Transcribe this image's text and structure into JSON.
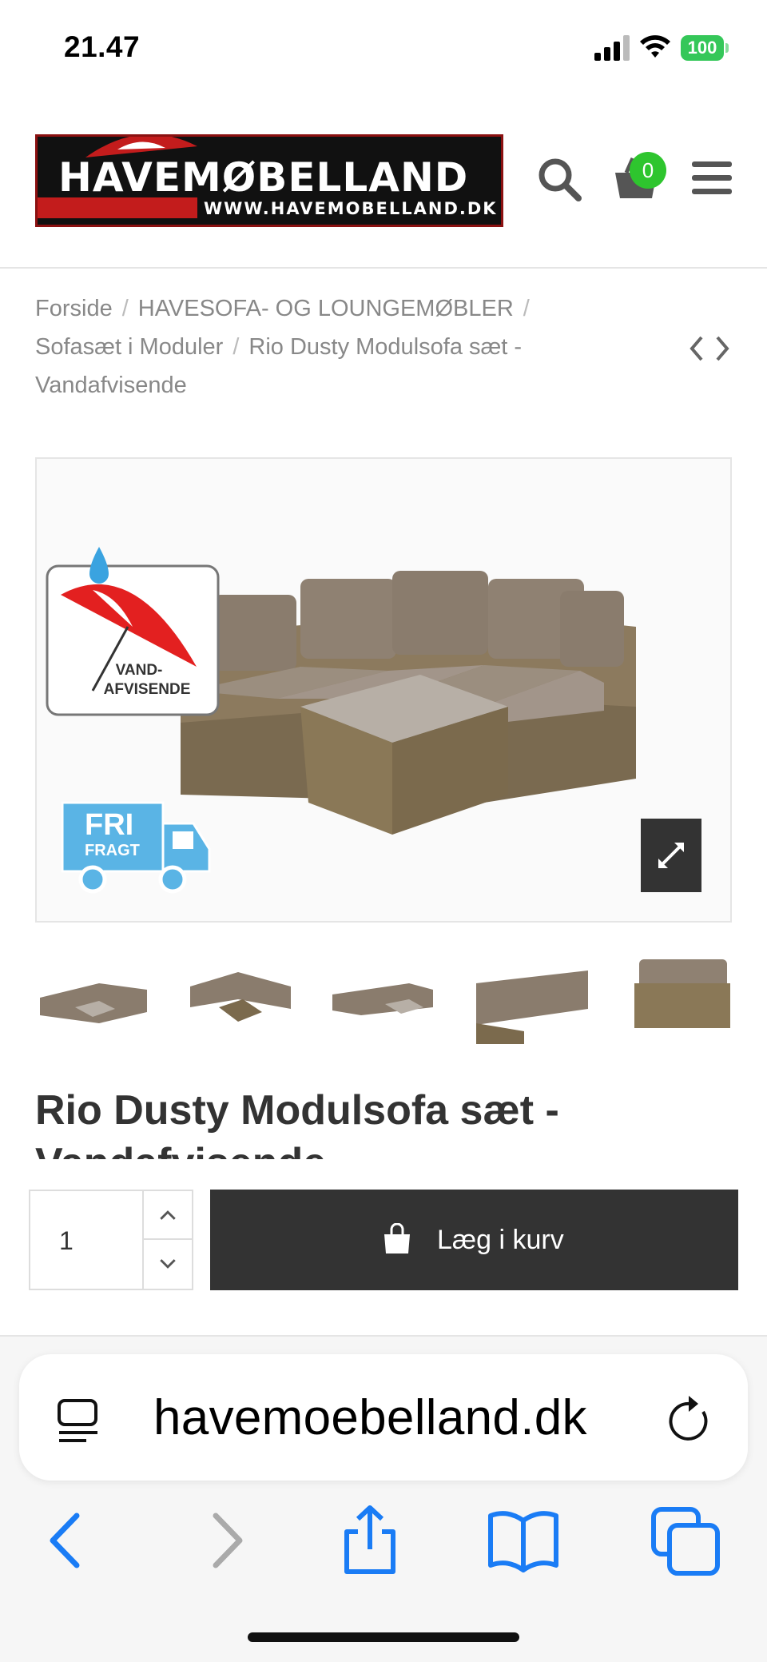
{
  "status_bar": {
    "time": "21.47",
    "battery": "100",
    "icons": [
      "cellular-signal-icon",
      "wifi-icon",
      "battery-icon"
    ]
  },
  "header": {
    "logo": {
      "name": "HAVEMØBELLAND",
      "url": "WWW.HAVEMOBELLAND.DK"
    },
    "cart_count": "0",
    "icons": [
      "search-icon",
      "cart-icon",
      "menu-icon"
    ]
  },
  "breadcrumb": {
    "items": [
      "Forside",
      "HAVESOFA- OG LOUNGEMØBLER",
      "Sofasæt i Moduler",
      "Rio Dusty Modulsofa sæt - Vandafvisende"
    ],
    "separator": "/"
  },
  "gallery": {
    "badge_water_text": [
      "VAND-",
      "AFVISENDE"
    ],
    "badge_fragt_text": [
      "FRI",
      "FRAGT"
    ],
    "thumbnail_count": 5
  },
  "product": {
    "title": "Rio Dusty Modulsofa sæt - Vandafvisende"
  },
  "cart_bar": {
    "quantity": "1",
    "add_label": "Læg i kurv"
  },
  "browser": {
    "url": "havemoebelland.dk",
    "toolbar": [
      "back-icon",
      "forward-icon",
      "share-icon",
      "bookmarks-icon",
      "tabs-icon"
    ]
  },
  "colors": {
    "accent_dark": "#333333",
    "badge_green": "#2ec52e",
    "ios_blue": "#1a7cf5",
    "battery_green": "#35c759",
    "brand_red": "#c31c1c"
  }
}
